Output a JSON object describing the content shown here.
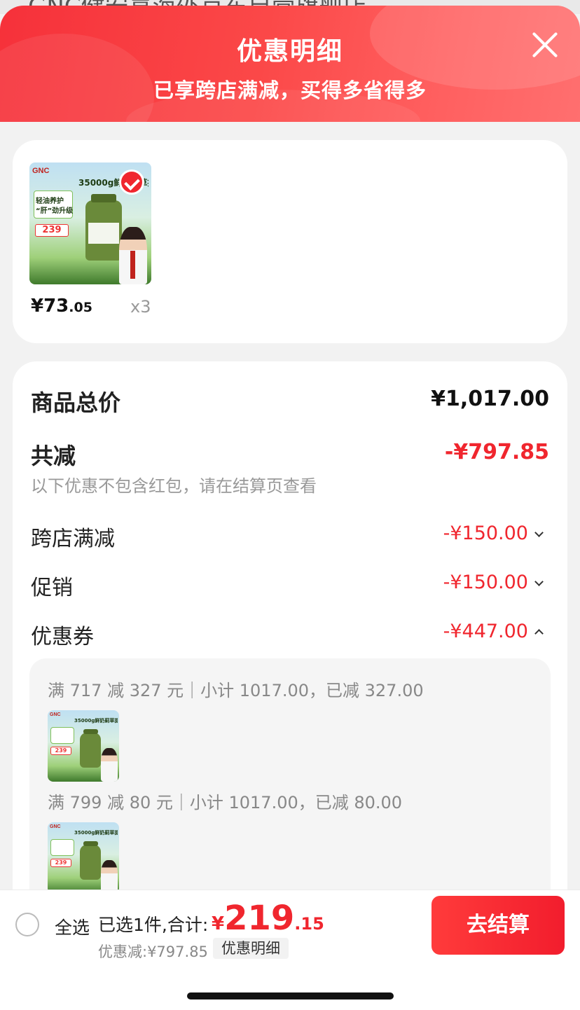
{
  "background_page": {
    "title_fragment": "GNC健安喜海外京东自营旗舰店"
  },
  "header": {
    "title": "优惠明细",
    "subtitle": "已享跨店满减，买得多省得多",
    "close_icon": "close-icon"
  },
  "product": {
    "image_text": {
      "brand": "GNC",
      "headline_line1": "轻油养护",
      "headline_line2": "“肝”劲升级",
      "badge": "35000g鲜奶蓟草提取",
      "price": "239"
    },
    "selected": true,
    "price_currency": "¥",
    "price_int": "73",
    "price_dec": ".05",
    "quantity": "x3"
  },
  "summary": {
    "total_label": "商品总价",
    "total_value": "¥1,017.00",
    "reduce_label": "共减",
    "reduce_value": "-¥797.85",
    "hint": "以下优惠不包含红包，请在结算页查看",
    "items": [
      {
        "label": "跨店满减",
        "value": "-¥150.00",
        "chevron": "chevron-down-icon"
      },
      {
        "label": "促销",
        "value": "-¥150.00",
        "chevron": "chevron-down-icon"
      },
      {
        "label": "优惠券",
        "value": "-¥447.00",
        "chevron": "chevron-up-icon"
      }
    ],
    "coupons": [
      {
        "text": "满 717 减 327 元｜小计 1017.00，已减 327.00"
      },
      {
        "text": "满 799 减 80 元｜小计 1017.00，已减 80.00"
      }
    ]
  },
  "bottom_bar": {
    "select_all": "全选",
    "selected_text": "已选1件,合计:",
    "total_currency": "¥",
    "total_int": "219",
    "total_dec": ".15",
    "discount_text": "优惠减:¥797.85",
    "detail_chip": "优惠明细",
    "checkout": "去结算"
  },
  "colors": {
    "accent": "#f0262e",
    "header_start": "#f6313a",
    "header_end": "#ff6f6f"
  }
}
